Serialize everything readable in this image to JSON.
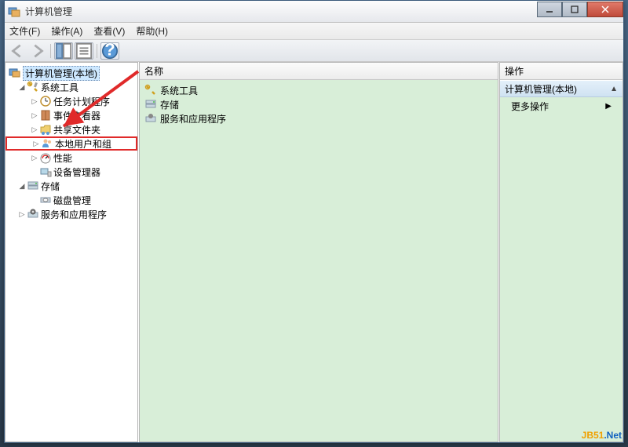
{
  "title": "计算机管理",
  "menubar": {
    "file": "文件(F)",
    "action": "操作(A)",
    "view": "查看(V)",
    "help": "帮助(H)"
  },
  "tree": {
    "root": "计算机管理(本地)",
    "sys_tools": "系统工具",
    "task_scheduler": "任务计划程序",
    "event_viewer": "事件查看器",
    "shared_folders": "共享文件夹",
    "local_users_groups": "本地用户和组",
    "performance": "性能",
    "device_manager": "设备管理器",
    "storage": "存储",
    "disk_management": "磁盘管理",
    "services_apps": "服务和应用程序"
  },
  "list": {
    "col_name": "名称",
    "item_sys_tools": "系统工具",
    "item_storage": "存储",
    "item_services_apps": "服务和应用程序"
  },
  "actions": {
    "header": "操作",
    "group": "计算机管理(本地)",
    "more": "更多操作"
  },
  "watermark": {
    "a": "JB51",
    "b": ".Net"
  }
}
